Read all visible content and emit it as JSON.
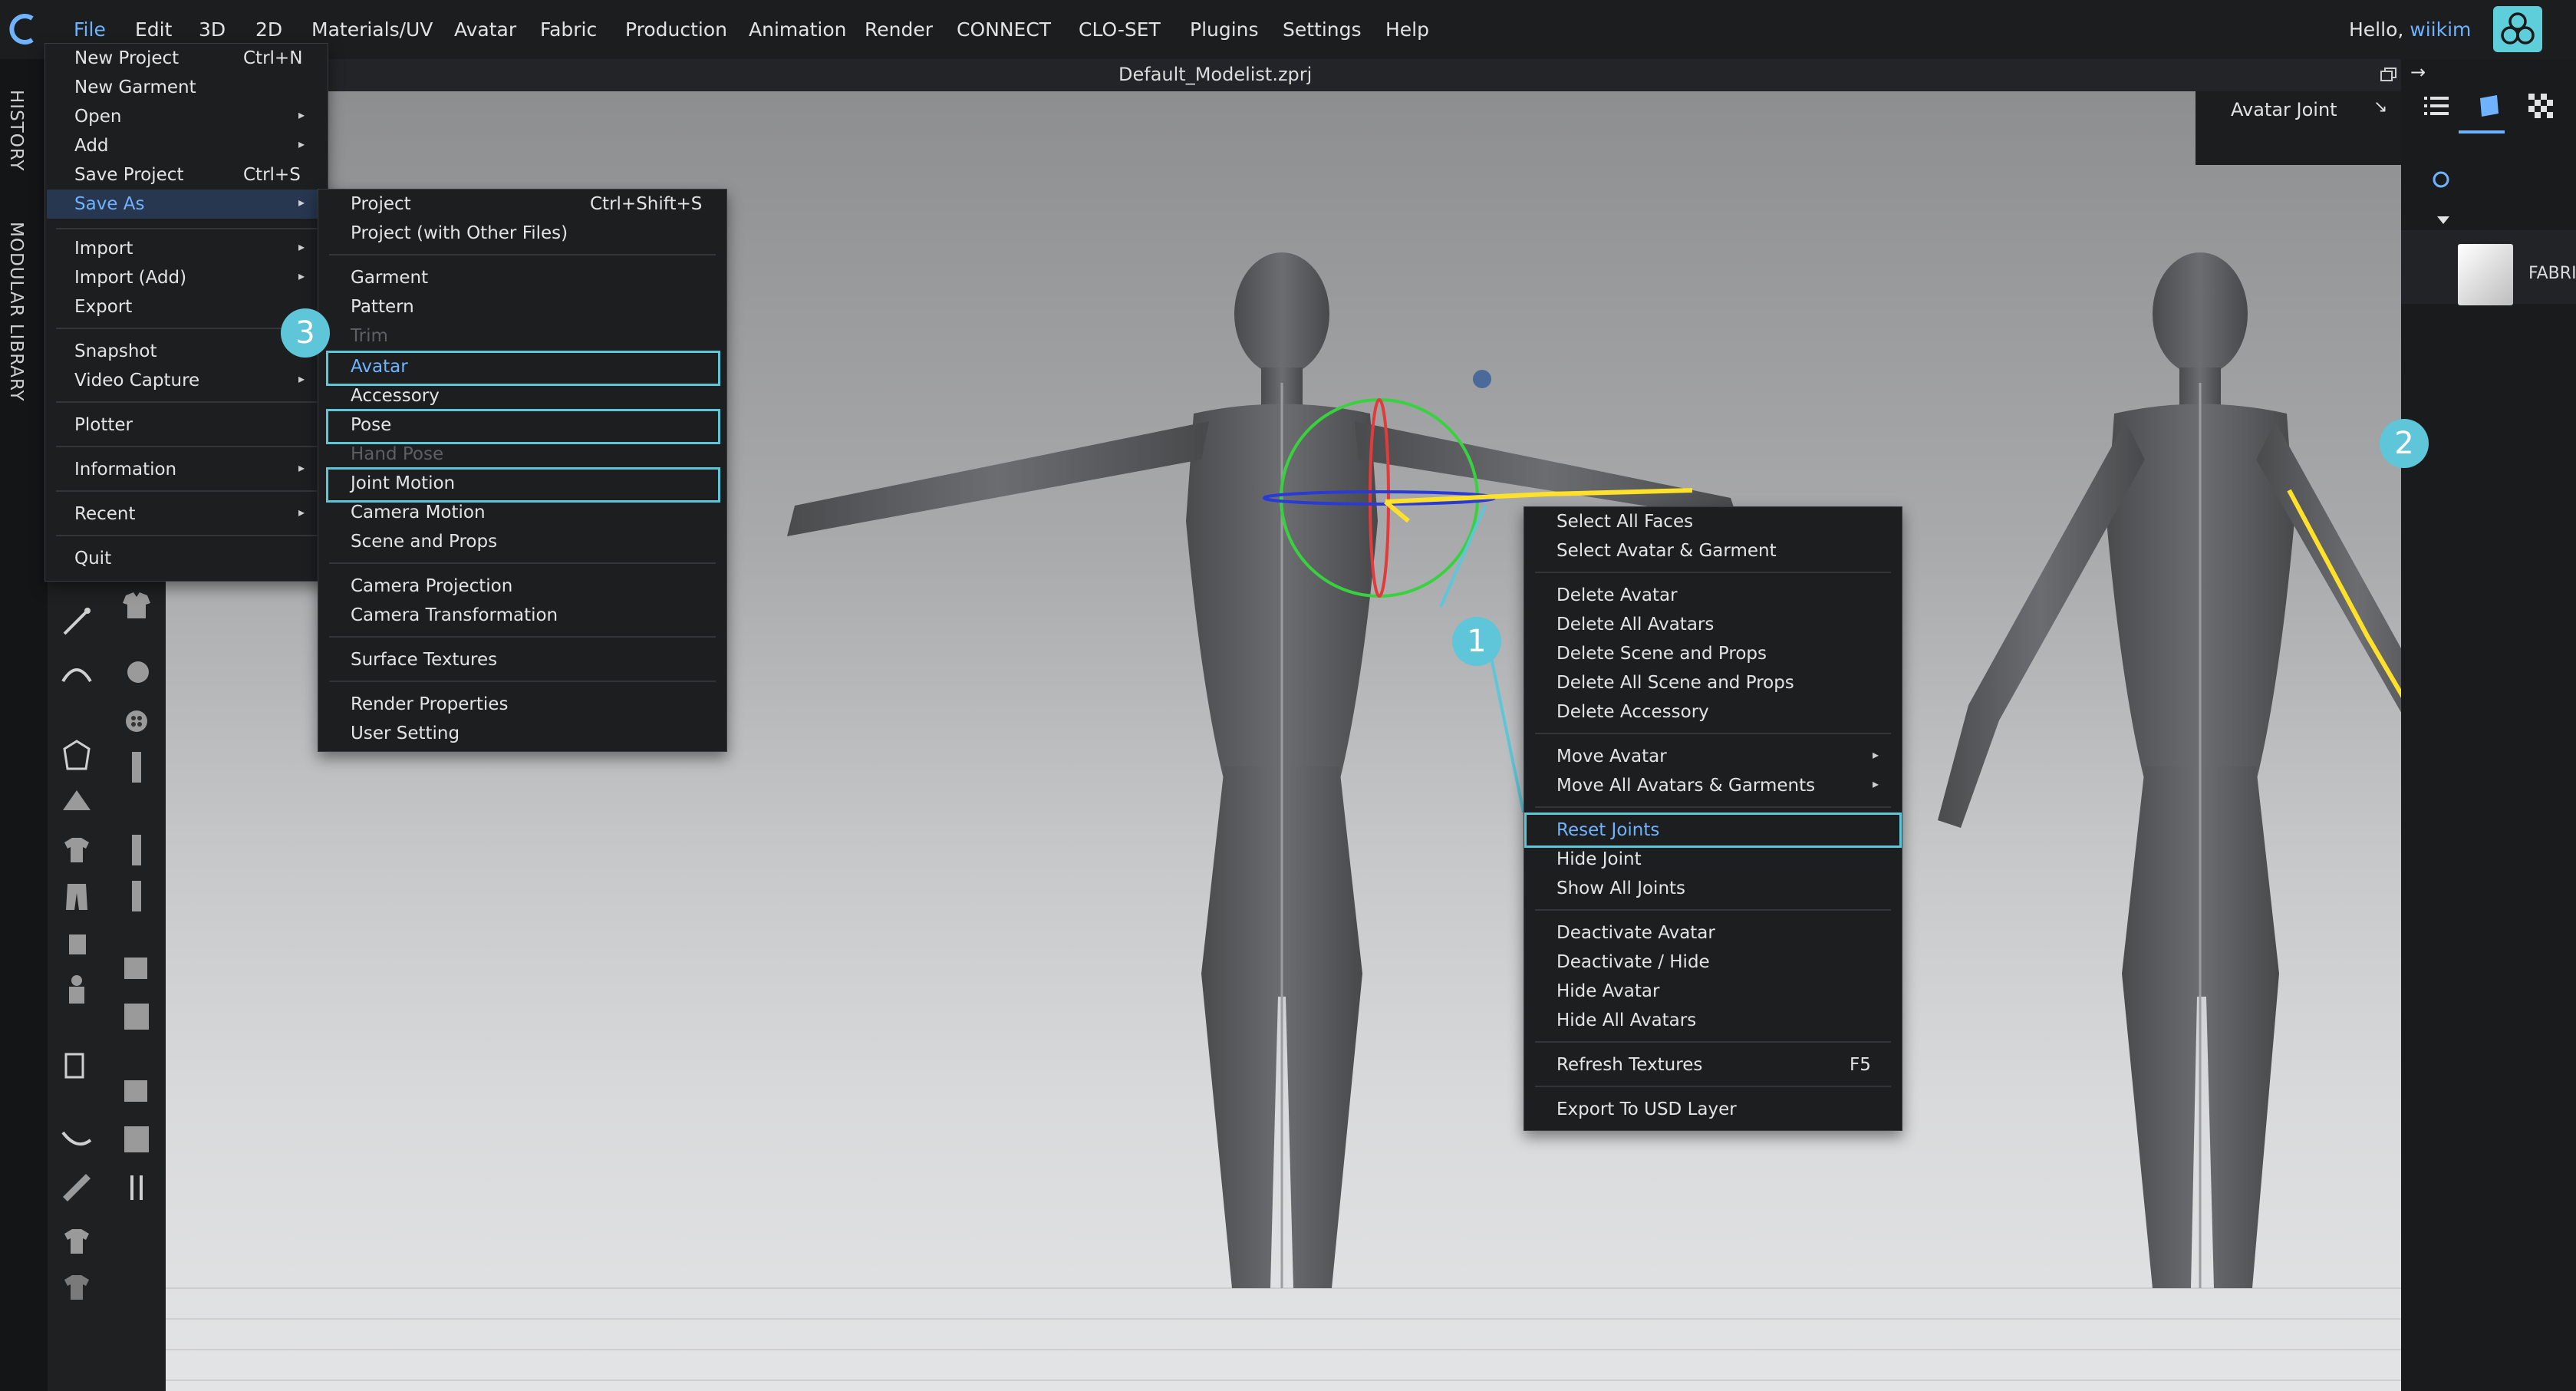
{
  "app": {
    "logo_icon": "clo-logo-icon",
    "menubar": [
      "File",
      "Edit",
      "3D",
      "2D",
      "Materials/UV",
      "Avatar",
      "Fabric",
      "Production",
      "Animation",
      "Render",
      "CONNECT",
      "CLO-SET",
      "Plugins",
      "Settings",
      "Help"
    ],
    "greeting_prefix": "Hello, ",
    "username": "wiikim",
    "file_title": "Default_Modelist.zprj",
    "accent_color": "#6fb3ff",
    "highlight_color": "#5ec6d8"
  },
  "side_tabs": [
    "HISTORY",
    "MODULAR LIBRARY"
  ],
  "joint_panel": {
    "label": "Avatar Joint",
    "arrow": "↘"
  },
  "right_panel": {
    "arrow": "→",
    "fabric_label": "FABRI"
  },
  "file_menu": {
    "items": [
      {
        "label": "New Project",
        "shortcut": "Ctrl+N"
      },
      {
        "label": "New Garment",
        "shortcut": ""
      },
      {
        "label": "Open",
        "shortcut": ""
      },
      {
        "label": "Add",
        "shortcut": ""
      },
      {
        "label": "Save Project",
        "shortcut": "Ctrl+S"
      },
      {
        "label": "Save As",
        "shortcut": ""
      },
      {
        "label": "Import",
        "shortcut": ""
      },
      {
        "label": "Import (Add)",
        "shortcut": ""
      },
      {
        "label": "Export",
        "shortcut": ""
      },
      {
        "label": "Snapshot",
        "shortcut": ""
      },
      {
        "label": "Video Capture",
        "shortcut": ""
      },
      {
        "label": "Plotter",
        "shortcut": ""
      },
      {
        "label": "Information",
        "shortcut": ""
      },
      {
        "label": "Recent",
        "shortcut": ""
      },
      {
        "label": "Quit",
        "shortcut": ""
      }
    ]
  },
  "save_as_menu": {
    "items": [
      {
        "label": "Project",
        "shortcut": "Ctrl+Shift+S"
      },
      {
        "label": "Project (with Other Files)",
        "shortcut": ""
      },
      {
        "label": "Garment",
        "shortcut": ""
      },
      {
        "label": "Pattern",
        "shortcut": ""
      },
      {
        "label": "Trim",
        "shortcut": ""
      },
      {
        "label": "Avatar",
        "shortcut": ""
      },
      {
        "label": "Accessory",
        "shortcut": ""
      },
      {
        "label": "Pose",
        "shortcut": ""
      },
      {
        "label": "Hand Pose",
        "shortcut": ""
      },
      {
        "label": "Joint Motion",
        "shortcut": ""
      },
      {
        "label": "Camera Motion",
        "shortcut": ""
      },
      {
        "label": "Scene and Props",
        "shortcut": ""
      },
      {
        "label": "Camera Projection",
        "shortcut": ""
      },
      {
        "label": "Camera Transformation",
        "shortcut": ""
      },
      {
        "label": "Surface Textures",
        "shortcut": ""
      },
      {
        "label": "Render Properties",
        "shortcut": ""
      },
      {
        "label": "User Setting",
        "shortcut": ""
      }
    ]
  },
  "context_menu": {
    "items": [
      {
        "label": "Select All Faces",
        "shortcut": ""
      },
      {
        "label": "Select Avatar & Garment",
        "shortcut": ""
      },
      {
        "label": "Delete Avatar",
        "shortcut": ""
      },
      {
        "label": "Delete All Avatars",
        "shortcut": ""
      },
      {
        "label": "Delete Scene and Props",
        "shortcut": ""
      },
      {
        "label": "Delete All Scene and Props",
        "shortcut": ""
      },
      {
        "label": "Delete Accessory",
        "shortcut": ""
      },
      {
        "label": "Move Avatar",
        "shortcut": ""
      },
      {
        "label": "Move All Avatars & Garments",
        "shortcut": ""
      },
      {
        "label": "Reset Joints",
        "shortcut": ""
      },
      {
        "label": "Hide Joint",
        "shortcut": ""
      },
      {
        "label": "Show All Joints",
        "shortcut": ""
      },
      {
        "label": "Deactivate Avatar",
        "shortcut": ""
      },
      {
        "label": "Deactivate / Hide",
        "shortcut": ""
      },
      {
        "label": "Hide Avatar",
        "shortcut": ""
      },
      {
        "label": "Hide All Avatars",
        "shortcut": ""
      },
      {
        "label": "Refresh Textures",
        "shortcut": "F5"
      },
      {
        "label": "Export To USD Layer",
        "shortcut": ""
      }
    ]
  },
  "badges": [
    "1",
    "2",
    "3"
  ]
}
